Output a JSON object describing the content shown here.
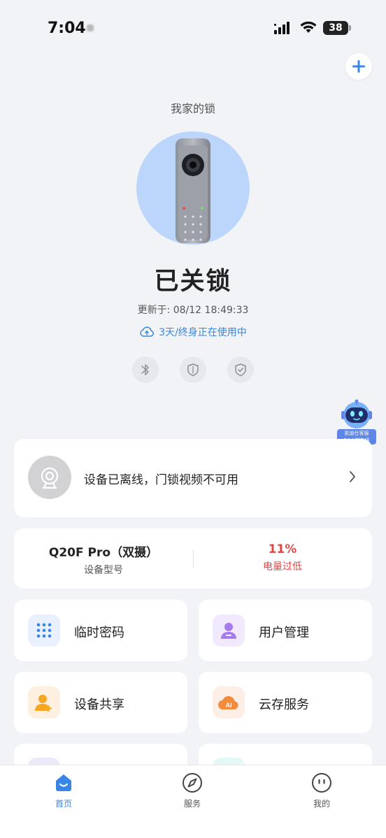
{
  "status_bar": {
    "time": "7:04",
    "battery": "38"
  },
  "header": {
    "device_name": "我家的锁"
  },
  "lock": {
    "status": "已关锁",
    "update_label": "更新于: 08/12 18:49:33",
    "cloud_text": "3天/终身正在使用中"
  },
  "service_bot": {
    "line1": "凯迪仕客服",
    "line2": "24小时在线"
  },
  "video_card": {
    "message": "设备已离线，门锁视频不可用"
  },
  "info": {
    "model_value": "Q20F Pro（双摄）",
    "model_label": "设备型号",
    "battery_value": "11%",
    "battery_label": "电量过低"
  },
  "tiles": [
    {
      "label": "临时密码"
    },
    {
      "label": "用户管理"
    },
    {
      "label": "设备共享"
    },
    {
      "label": "云存服务"
    }
  ],
  "cloud_badge": "AI",
  "tabbar": {
    "tabs": [
      {
        "label": "首页"
      },
      {
        "label": "服务"
      },
      {
        "label": "我的"
      }
    ]
  },
  "colors": {
    "accent": "#3a86e6",
    "warning": "#e04848",
    "background": "#f2f3f7"
  }
}
